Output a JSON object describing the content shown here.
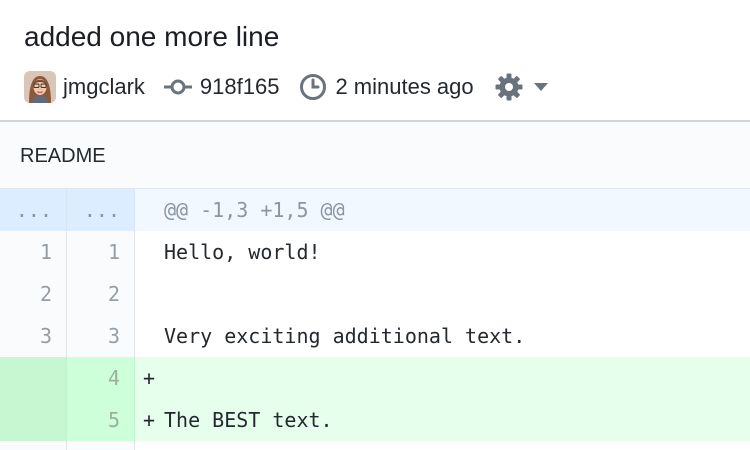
{
  "commit": {
    "title": "added one more line",
    "author": "jmgclark",
    "sha": "918f165",
    "time": "2 minutes ago"
  },
  "icons": {
    "commit": "commit-icon",
    "clock": "clock-icon",
    "settings": "gear-icon",
    "dropdown": "caret-down-icon"
  },
  "file": {
    "name": "README"
  },
  "diff": {
    "hunk": {
      "old_ln": "...",
      "new_ln": "...",
      "header": "@@ -1,3 +1,5 @@"
    },
    "lines": [
      {
        "old": "1",
        "new": "1",
        "marker": "",
        "text": "Hello, world!"
      },
      {
        "old": "2",
        "new": "2",
        "marker": "",
        "text": ""
      },
      {
        "old": "3",
        "new": "3",
        "marker": "",
        "text": "Very exciting additional text."
      },
      {
        "old": "",
        "new": "4",
        "marker": "+",
        "text": ""
      },
      {
        "old": "",
        "new": "5",
        "marker": "+",
        "text": "The BEST text."
      }
    ]
  },
  "colors": {
    "added_bg": "#e6ffed",
    "added_gutter": "#cdffd8",
    "hunk_bg": "#f1f8ff",
    "hunk_gutter": "#dbedff",
    "line_number": "#959da5"
  }
}
